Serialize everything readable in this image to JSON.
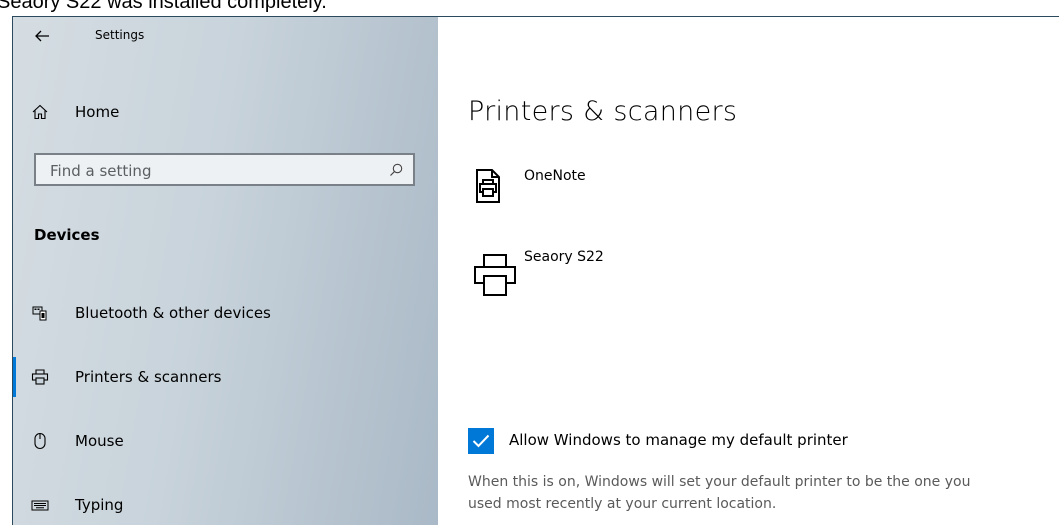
{
  "caption": "Seaory S22 was installed completely.",
  "window": {
    "title": "Settings"
  },
  "sidebar": {
    "home_label": "Home",
    "search_placeholder": "Find a setting",
    "section": "Devices",
    "items": [
      {
        "label": "Bluetooth & other devices",
        "icon": "bluetooth-devices-icon"
      },
      {
        "label": "Printers & scanners",
        "icon": "printer-icon",
        "selected": true
      },
      {
        "label": "Mouse",
        "icon": "mouse-icon"
      },
      {
        "label": "Typing",
        "icon": "keyboard-icon"
      }
    ]
  },
  "main": {
    "title": "Printers & scanners",
    "printers": [
      {
        "name": "OneNote",
        "icon": "onenote-printer-icon"
      },
      {
        "name": "Seaory S22",
        "icon": "printer-icon"
      }
    ],
    "default_printer": {
      "label": "Allow Windows to manage my default printer",
      "checked": true,
      "description_line1": "When this is on, Windows will set your default printer to be the one you",
      "description_line2": "used most recently at your current location."
    }
  },
  "colors": {
    "accent": "#0078d7",
    "sidebar": "#c8d3db"
  }
}
